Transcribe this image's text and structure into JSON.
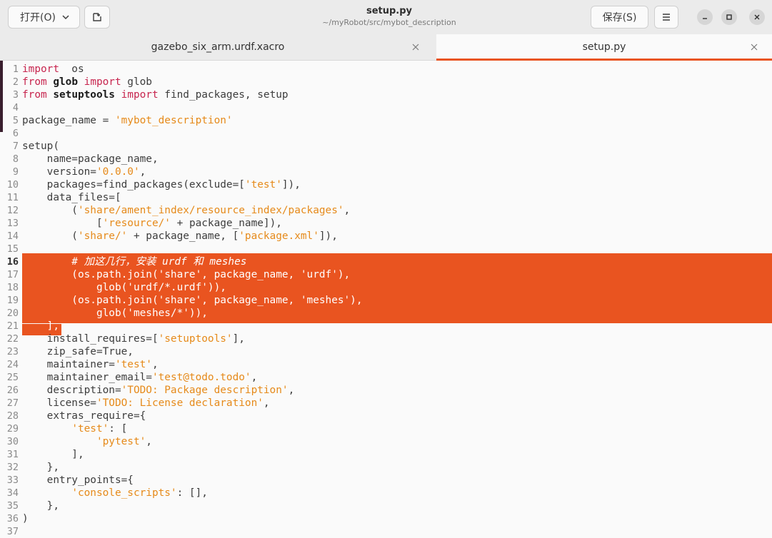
{
  "header": {
    "open_label": "打开(O)",
    "save_label": "保存(S)",
    "title": "setup.py",
    "subtitle": "~/myRobot/src/mybot_description"
  },
  "tabs": [
    {
      "label": "gazebo_six_arm.urdf.xacro",
      "active": false
    },
    {
      "label": "setup.py",
      "active": true
    }
  ],
  "colors": {
    "accent": "#e95420",
    "keyword": "#c7254e",
    "string": "#e68a1a"
  },
  "editor": {
    "lines": [
      {
        "n": "1",
        "segs": [
          [
            "kw",
            "import"
          ],
          [
            "",
            "  os"
          ]
        ]
      },
      {
        "n": "2",
        "segs": [
          [
            "kw",
            "from"
          ],
          [
            "",
            " "
          ],
          [
            "bld",
            "glob"
          ],
          [
            "",
            " "
          ],
          [
            "kw",
            "import"
          ],
          [
            "",
            " glob"
          ]
        ]
      },
      {
        "n": "3",
        "segs": [
          [
            "kw",
            "from"
          ],
          [
            "",
            " "
          ],
          [
            "bld",
            "setuptools"
          ],
          [
            "",
            " "
          ],
          [
            "kw",
            "import"
          ],
          [
            "",
            " find_packages, setup"
          ]
        ]
      },
      {
        "n": "4",
        "segs": []
      },
      {
        "n": "5",
        "segs": [
          [
            "",
            "package_name = "
          ],
          [
            "str",
            "'mybot_description'"
          ]
        ]
      },
      {
        "n": "6",
        "segs": []
      },
      {
        "n": "7",
        "segs": [
          [
            "",
            "setup("
          ]
        ]
      },
      {
        "n": "8",
        "segs": [
          [
            "",
            "    name=package_name,"
          ]
        ]
      },
      {
        "n": "9",
        "segs": [
          [
            "",
            "    version="
          ],
          [
            "str",
            "'0.0.0'"
          ],
          [
            "",
            ","
          ]
        ]
      },
      {
        "n": "10",
        "segs": [
          [
            "",
            "    packages=find_packages(exclude=["
          ],
          [
            "str",
            "'test'"
          ],
          [
            "",
            "]),"
          ]
        ]
      },
      {
        "n": "11",
        "segs": [
          [
            "",
            "    data_files=["
          ]
        ]
      },
      {
        "n": "12",
        "segs": [
          [
            "",
            "        ("
          ],
          [
            "str",
            "'share/ament_index/resource_index/packages'"
          ],
          [
            "",
            ","
          ]
        ]
      },
      {
        "n": "13",
        "segs": [
          [
            "",
            "            ["
          ],
          [
            "str",
            "'resource/'"
          ],
          [
            "",
            " + package_name]),"
          ]
        ]
      },
      {
        "n": "14",
        "segs": [
          [
            "",
            "        ("
          ],
          [
            "str",
            "'share/'"
          ],
          [
            "",
            " + package_name, ["
          ],
          [
            "str",
            "'package.xml'"
          ],
          [
            "",
            "]),"
          ]
        ]
      },
      {
        "n": "15",
        "segs": []
      },
      {
        "n": "16",
        "hl": true,
        "cur": true,
        "segs": [
          [
            "cm",
            "        # 加这几行，安装 urdf 和 meshes"
          ]
        ]
      },
      {
        "n": "17",
        "hl": true,
        "segs": [
          [
            "",
            "        (os.path.join('share', package_name, 'urdf'),"
          ]
        ]
      },
      {
        "n": "18",
        "hl": true,
        "segs": [
          [
            "",
            "            glob('urdf/*.urdf')),"
          ]
        ]
      },
      {
        "n": "19",
        "hl": true,
        "segs": [
          [
            "",
            "        (os.path.join('share', package_name, 'meshes'),"
          ]
        ]
      },
      {
        "n": "20",
        "hl": true,
        "segs": [
          [
            "",
            "            glob('meshes/*')),"
          ]
        ]
      },
      {
        "n": "21",
        "hl": true,
        "segs": [
          [
            "",
            "    ],"
          ]
        ]
      },
      {
        "n": "22",
        "segs": [
          [
            "",
            "    install_requires=["
          ],
          [
            "str",
            "'setuptools'"
          ],
          [
            "",
            "],"
          ]
        ]
      },
      {
        "n": "23",
        "segs": [
          [
            "",
            "    zip_safe=True,"
          ]
        ]
      },
      {
        "n": "24",
        "segs": [
          [
            "",
            "    maintainer="
          ],
          [
            "str",
            "'test'"
          ],
          [
            "",
            ","
          ]
        ]
      },
      {
        "n": "25",
        "segs": [
          [
            "",
            "    maintainer_email="
          ],
          [
            "str",
            "'test@todo.todo'"
          ],
          [
            "",
            ","
          ]
        ]
      },
      {
        "n": "26",
        "segs": [
          [
            "",
            "    description="
          ],
          [
            "str",
            "'TODO: Package description'"
          ],
          [
            "",
            ","
          ]
        ]
      },
      {
        "n": "27",
        "segs": [
          [
            "",
            "    license="
          ],
          [
            "str",
            "'TODO: License declaration'"
          ],
          [
            "",
            ","
          ]
        ]
      },
      {
        "n": "28",
        "segs": [
          [
            "",
            "    extras_require={"
          ]
        ]
      },
      {
        "n": "29",
        "segs": [
          [
            "",
            "        "
          ],
          [
            "str",
            "'test'"
          ],
          [
            "",
            ": ["
          ]
        ]
      },
      {
        "n": "30",
        "segs": [
          [
            "",
            "            "
          ],
          [
            "str",
            "'pytest'"
          ],
          [
            "",
            ","
          ]
        ]
      },
      {
        "n": "31",
        "segs": [
          [
            "",
            "        ],"
          ]
        ]
      },
      {
        "n": "32",
        "segs": [
          [
            "",
            "    },"
          ]
        ]
      },
      {
        "n": "33",
        "segs": [
          [
            "",
            "    entry_points={"
          ]
        ]
      },
      {
        "n": "34",
        "segs": [
          [
            "",
            "        "
          ],
          [
            "str",
            "'console_scripts'"
          ],
          [
            "",
            ": [],"
          ]
        ]
      },
      {
        "n": "35",
        "segs": [
          [
            "",
            "    },"
          ]
        ]
      },
      {
        "n": "36",
        "segs": [
          [
            "",
            ")"
          ]
        ]
      },
      {
        "n": "37",
        "segs": []
      }
    ]
  }
}
